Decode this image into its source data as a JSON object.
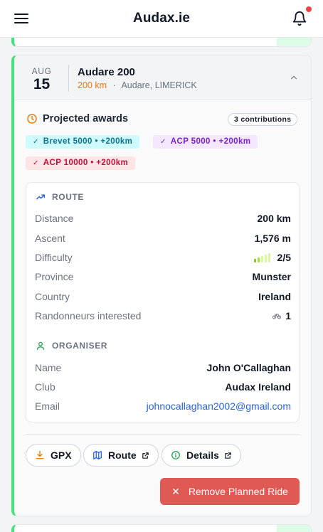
{
  "header": {
    "title": "Audax.ie"
  },
  "event": {
    "month": "AUG",
    "day": "15",
    "name": "Audare 200",
    "distance": "200 km",
    "separator": "·",
    "location": "Audare, LIMERICK"
  },
  "awards": {
    "title": "Projected awards",
    "contributions": "3 contributions",
    "badges": [
      {
        "label": "Brevet 5000 • +200km"
      },
      {
        "label": "ACP 5000 • +200km"
      },
      {
        "label": "ACP 10000 • +200km"
      }
    ]
  },
  "route": {
    "title": "ROUTE",
    "distance_label": "Distance",
    "distance_value": "200 km",
    "ascent_label": "Ascent",
    "ascent_value": "1,576 m",
    "difficulty_label": "Difficulty",
    "difficulty_value": "2/5",
    "difficulty_level": 2,
    "difficulty_max": 5,
    "province_label": "Province",
    "province_value": "Munster",
    "country_label": "Country",
    "country_value": "Ireland",
    "interested_label": "Randonneurs interested",
    "interested_value": "1"
  },
  "organiser": {
    "title": "ORGANISER",
    "name_label": "Name",
    "name_value": "John O'Callaghan",
    "club_label": "Club",
    "club_value": "Audax Ireland",
    "email_label": "Email",
    "email_value": "johnocallaghan2002@gmail.com"
  },
  "actions": {
    "gpx": "GPX",
    "route": "Route",
    "details": "Details",
    "remove": "Remove Planned Ride"
  },
  "colors": {
    "accent_green": "#4ade80",
    "distance_orange": "#ea7a12",
    "remove_red": "#e05a55",
    "link_blue": "#2563eb"
  },
  "icons": {
    "menu": "hamburger-icon",
    "bell": "bell-icon",
    "awards": "clock-icon",
    "route": "trending-up-icon",
    "organiser": "user-icon",
    "gpx": "download-icon",
    "route_btn": "map-icon",
    "details": "info-icon",
    "external": "external-link-icon",
    "collapse": "chevron-up-icon"
  }
}
